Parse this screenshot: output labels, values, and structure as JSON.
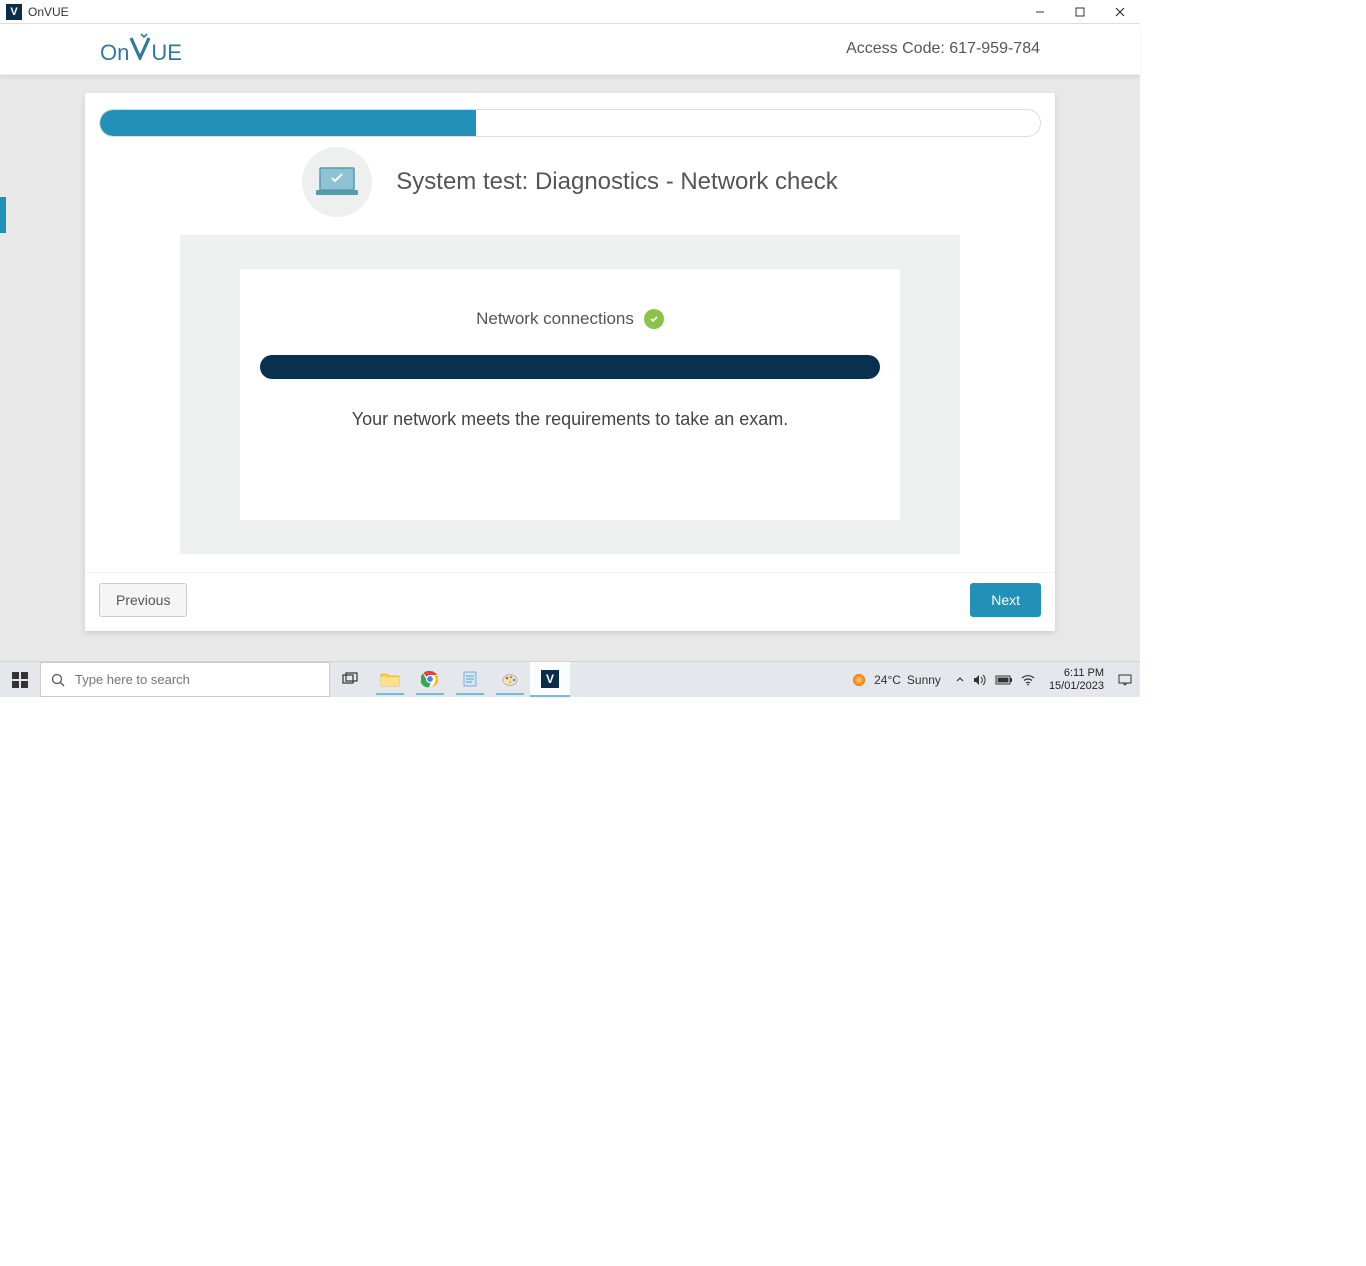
{
  "window": {
    "title": "OnVUE"
  },
  "header": {
    "logo_on": "On",
    "logo_v": "V",
    "logo_ue": "UE",
    "access_code_label": "Access Code: 617-959-784"
  },
  "progress": {
    "percent": 40
  },
  "page": {
    "title": "System test: Diagnostics - Network check"
  },
  "network": {
    "label": "Network connections",
    "inner_percent": 100,
    "message": "Your network meets the requirements to take an exam."
  },
  "buttons": {
    "previous": "Previous",
    "next": "Next"
  },
  "taskbar": {
    "search_placeholder": "Type here to search",
    "weather_temp": "24°C",
    "weather_cond": "Sunny",
    "time": "6:11 PM",
    "date": "15/01/2023"
  }
}
